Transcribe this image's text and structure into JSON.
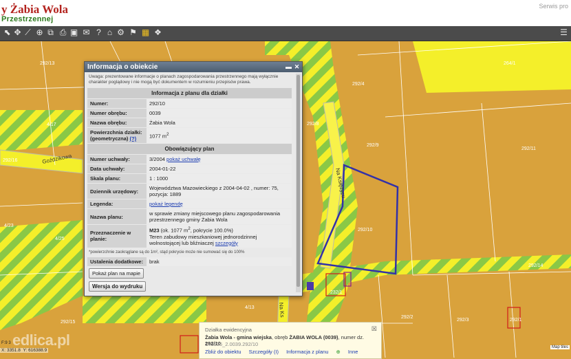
{
  "header": {
    "title": "y Żabia Wola",
    "subtitle": "Przestrzennej",
    "top_right": "Serwis pro"
  },
  "toolbar": {
    "icons": [
      "pointer-icon",
      "pan-icon",
      "measure-icon",
      "zoom-icon",
      "layers-icon",
      "print-icon",
      "comment-icon",
      "help-icon",
      "home-icon",
      "settings-icon",
      "grid-icon",
      "info-icon"
    ]
  },
  "map": {
    "parcel_labels": [
      "292/13",
      "4/17",
      "292/16",
      "4/13",
      "292/4",
      "292/9",
      "292/8",
      "232/1",
      "292/11",
      "292/10",
      "232/2",
      "292/3",
      "292/2",
      "292/1",
      "292/4",
      "264/1",
      "292/14",
      "292/15",
      "4/23",
      "4/25"
    ],
    "street_labels": [
      "Goździkowa",
      "Na Księżycu",
      "Na Ks"
    ]
  },
  "dialog": {
    "title": "Informacja o obiekcie",
    "note": "Uwaga: prezentowane informacje o planach zagospodarowania przestrzennego mają wyłącznie charakter poglądowy i nie mogą być dokumentem w rozumieniu przepisów prawa.",
    "section1": "Informacja z planu dla działki",
    "numer_label": "Numer:",
    "numer": "292/10",
    "numer_obrebu_label": "Numer obrębu:",
    "numer_obrebu": "0039",
    "nazwa_obrebu_label": "Nazwa obrębu:",
    "nazwa_obrebu": "Żabia Wola",
    "powierzchnia_label": "Powierzchnia działki:",
    "powierzchnia_label2": "(geometryczna)",
    "powierzchnia_help": "(?)",
    "powierzchnia": "1077 m",
    "sup2": "2",
    "section2": "Obowiązujący plan",
    "numer_uchwaly_label": "Numer uchwały:",
    "numer_uchwaly": "3/2004",
    "pokaz_uchwale": "pokaż uchwałę",
    "data_uchwaly_label": "Data uchwały:",
    "data_uchwaly": "2004-01-22",
    "skala_label": "Skala planu:",
    "skala": "1 : 1000",
    "dziennik_label": "Dziennik urzędowy:",
    "dziennik": "Województwa Mazowieckiego z 2004-04-02 , numer: 75, pozycja: 1889",
    "legenda_label": "Legenda:",
    "pokaz_legende": "pokaż legendę",
    "nazwa_planu_label": "Nazwa planu:",
    "nazwa_planu": "w sprawie zmiany miejscowego planu zagospodarowania przestrzennego gminy Żabia Wola",
    "przeznaczenie_label": "Przeznaczenie w planie:",
    "przeznaczenie_code": "M23",
    "przeznaczenie_area": " (ok. 1077 m",
    "przeznaczenie_cov": ", pokrycie 100.0%)",
    "przeznaczenie_desc": "Teren zabudowy mieszkaniowej jednorodzinnej wolnostojącej lub bliźniaczej",
    "szczegoly": "szczegóły",
    "footnote": "*powierzchnie zaokrąglane są do 1m², stąd pokrycie może nie sumować się do 100%",
    "ustalenia_label": "Ustalenia dodatkowe:",
    "ustalenia": "brak",
    "pokaz_plan": "Pokaż plan na mapie",
    "wersja_druk": "Wersja do wydruku"
  },
  "popup": {
    "title": "Działka ewidencyjna",
    "line1_bold": "Żabia Wola - gmina wiejska",
    "line1_mid": ", obręb ",
    "line1_obreb": "ŻABIA WOLA (0039)",
    "line1_end": ", numer dz.",
    "line1_num": "292/10",
    "line2": "140506_2.0039.292/10",
    "link_zoom": "Zbliż do obiektu",
    "link_details": "Szczegóły (I)",
    "link_plan": "Informacja z planu",
    "link_more": "Inne"
  },
  "status": {
    "watermark": "edlica.pl",
    "x": "3351.8",
    "y": "616388.9",
    "side": "F:9 3",
    "map_tiles": "Map tiles"
  },
  "colors": {
    "parcel_fill": "#d9a23c",
    "yellow_zone": "#f4ef2a",
    "stripe_green": "#8ac846",
    "selection": "#3331a8",
    "building": "#d21919",
    "dialog_title": "#5a6b7e",
    "link": "#1a3bb0"
  }
}
